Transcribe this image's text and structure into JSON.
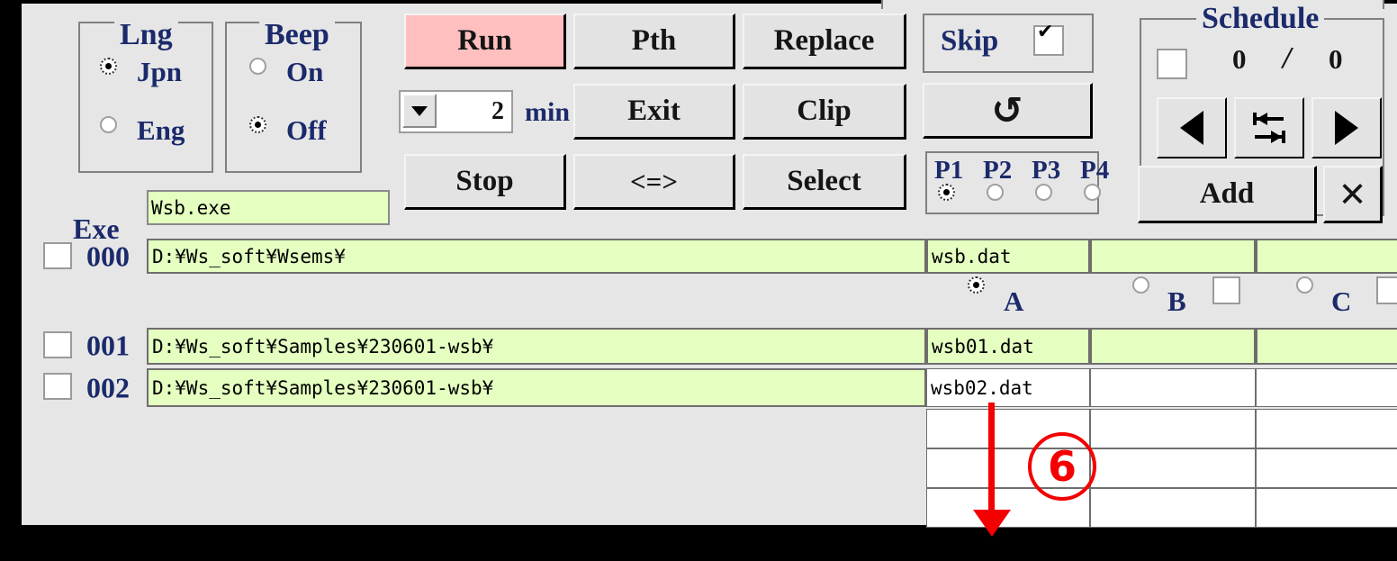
{
  "app": {
    "bg_color": "#e6e6e6",
    "accent_label_color": "#1b2a6b",
    "field_green": "#e4ffc0",
    "run_pink": "#ffbfbf",
    "annotation_color": "#f40000"
  },
  "lng_group": {
    "title": "Lng",
    "options": [
      {
        "label": "Jpn",
        "selected": true
      },
      {
        "label": "Eng",
        "selected": false
      }
    ]
  },
  "beep_group": {
    "title": "Beep",
    "options": [
      {
        "label": "On",
        "selected": false
      },
      {
        "label": "Off",
        "selected": true
      }
    ]
  },
  "buttons": {
    "run": "Run",
    "pth": "Pth",
    "replace": "Replace",
    "exit": "Exit",
    "clip": "Clip",
    "reload_icon": "↺",
    "stop": "Stop",
    "swap": "<=>",
    "select": "Select"
  },
  "timer": {
    "dropdown_icon": "chevron-down-icon",
    "value": "2",
    "unit": "min"
  },
  "skip": {
    "label": "Skip",
    "checked": true,
    "check_glyph": "✔"
  },
  "profiles": {
    "items": [
      {
        "label": "P1",
        "selected": true
      },
      {
        "label": "P2",
        "selected": false
      },
      {
        "label": "P3",
        "selected": false
      },
      {
        "label": "P4",
        "selected": false
      }
    ]
  },
  "schedule": {
    "title": "Schedule",
    "enabled": false,
    "current": "0",
    "separator": "/",
    "total": "0",
    "prev_icon": "triangle-left-icon",
    "jump_icon": "jump-to-icon",
    "next_icon": "triangle-right-icon",
    "add_label": "Add",
    "delete_glyph": "✕"
  },
  "exe": {
    "label": "Exe",
    "value": "Wsb.exe"
  },
  "abc_row": {
    "options": [
      {
        "label": "A",
        "selected": true,
        "has_checkbox": false,
        "checked": false
      },
      {
        "label": "B",
        "selected": false,
        "has_checkbox": true,
        "checked": false
      },
      {
        "label": "C",
        "selected": false,
        "has_checkbox": true,
        "checked": false
      }
    ]
  },
  "rows": [
    {
      "index": "000",
      "checked": false,
      "path": "D:¥Ws_soft¥Wsems¥",
      "file": "wsb.dat",
      "col3": "",
      "col4": "",
      "green": true,
      "file_green": true
    },
    {
      "index": "001",
      "checked": false,
      "path": "D:¥Ws_soft¥Samples¥230601-wsb¥",
      "file": "wsb01.dat",
      "col3": "",
      "col4": "",
      "green": true,
      "file_green": true
    },
    {
      "index": "002",
      "checked": false,
      "path": "D:¥Ws_soft¥Samples¥230601-wsb¥",
      "file": "wsb02.dat",
      "col3": "",
      "col4": "",
      "green": true,
      "file_green": false
    }
  ],
  "empty_rows": [
    {
      "file": "",
      "has_caret": true
    },
    {
      "file": "",
      "has_caret": false
    },
    {
      "file": "",
      "has_caret": false
    }
  ],
  "annotation": {
    "step_number": "6",
    "arrow": "down-arrow"
  }
}
